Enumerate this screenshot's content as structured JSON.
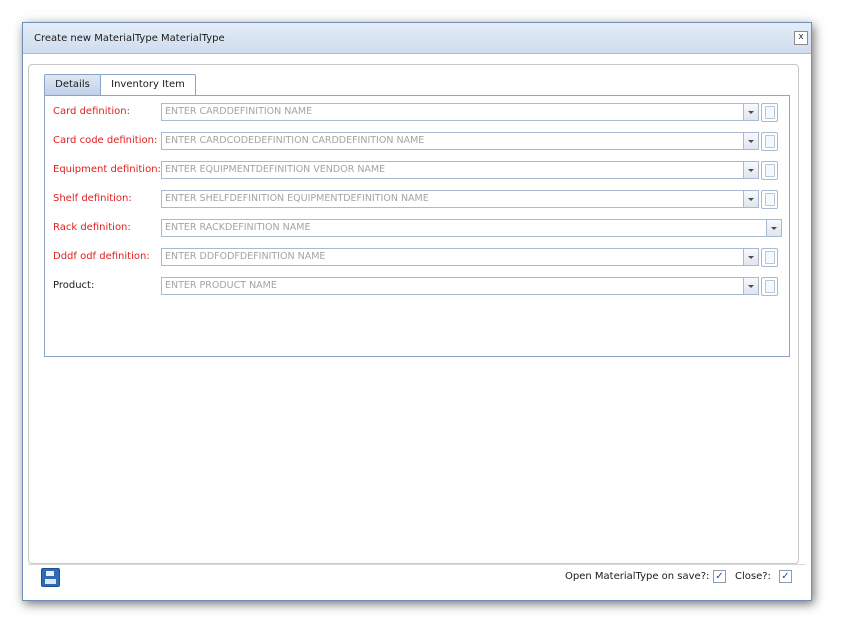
{
  "window": {
    "title": "Create new MaterialType MaterialType",
    "close_label": "x"
  },
  "tabs": [
    {
      "label": "Details"
    },
    {
      "label": "Inventory Item"
    }
  ],
  "fields": [
    {
      "label": "Card definition:",
      "placeholder": "ENTER CARDDEFINITION NAME",
      "required": true
    },
    {
      "label": "Card code definition:",
      "placeholder": "ENTER CARDCODEDEFINITION CARDDEFINITION NAME",
      "required": true
    },
    {
      "label": "Equipment definition:",
      "placeholder": "ENTER EQUIPMENTDEFINITION VENDOR NAME",
      "required": true
    },
    {
      "label": "Shelf definition:",
      "placeholder": "ENTER SHELFDEFINITION EQUIPMENTDEFINITION NAME",
      "required": true
    },
    {
      "label": "Rack definition:",
      "placeholder": "ENTER RACKDEFINITION NAME",
      "required": true
    },
    {
      "label": "Dddf odf definition:",
      "placeholder": "ENTER DDFODFDEFINITION NAME",
      "required": true
    },
    {
      "label": "Product:",
      "placeholder": "ENTER PRODUCT NAME",
      "required": false
    }
  ],
  "footer": {
    "open_on_save_label": "Open MaterialType on save?:",
    "open_on_save_checked": true,
    "close_label": "Close?:",
    "close_checked": true,
    "check_mark": "✓"
  },
  "colors": {
    "required_label": "#e0201f",
    "accent": "#2f6bb5"
  },
  "icons": [
    "save-icon",
    "close-icon",
    "dropdown-arrow-icon",
    "lookup-icon",
    "checkbox-checked-icon"
  ]
}
